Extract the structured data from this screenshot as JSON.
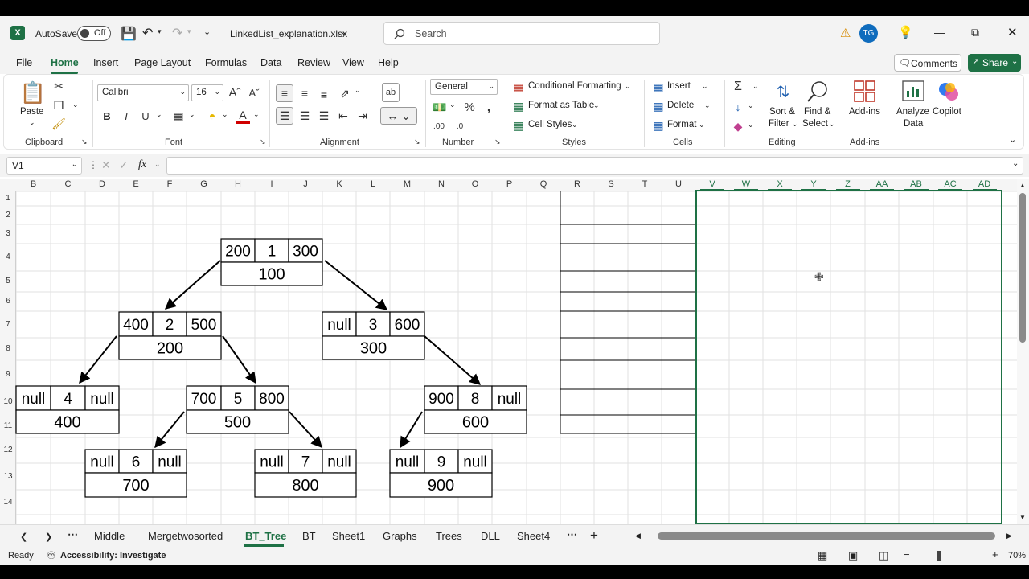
{
  "titlebar": {
    "autosave_label": "AutoSave",
    "autosave_state": "Off",
    "filename": "LinkedList_explanation.xlsx",
    "search_placeholder": "Search",
    "user_initials": "TG"
  },
  "menus": [
    "File",
    "Home",
    "Insert",
    "Page Layout",
    "Formulas",
    "Data",
    "Review",
    "View",
    "Help"
  ],
  "menu_active": "Home",
  "actions": {
    "comments": "Comments",
    "share": "Share"
  },
  "ribbon": {
    "clipboard": {
      "paste": "Paste",
      "label": "Clipboard"
    },
    "font": {
      "name": "Calibri",
      "size": "16",
      "label": "Font"
    },
    "alignment": {
      "label": "Alignment"
    },
    "number": {
      "format": "General",
      "label": "Number"
    },
    "styles": {
      "conditional": "Conditional Formatting",
      "table": "Format as Table",
      "cell": "Cell Styles",
      "label": "Styles"
    },
    "cells": {
      "insert": "Insert",
      "delete": "Delete",
      "format": "Format",
      "label": "Cells"
    },
    "editing": {
      "sort1": "Sort &",
      "sort2": "Filter",
      "find1": "Find &",
      "find2": "Select",
      "label": "Editing"
    },
    "addins": {
      "addins": "Add-ins",
      "label": "Add-ins"
    },
    "analyze": {
      "line1": "Analyze",
      "line2": "Data"
    },
    "copilot": "Copilot"
  },
  "formula_bar": {
    "cell_ref": "V1",
    "fx": "fx"
  },
  "columns": [
    "B",
    "C",
    "D",
    "E",
    "F",
    "G",
    "H",
    "I",
    "J",
    "K",
    "L",
    "M",
    "N",
    "O",
    "P",
    "Q",
    "R",
    "S",
    "T",
    "U",
    "V",
    "W",
    "X",
    "Y",
    "Z",
    "AA",
    "AB",
    "AC",
    "AD"
  ],
  "rows": [
    "1",
    "2",
    "3",
    "4",
    "5",
    "6",
    "7",
    "8",
    "9",
    "10",
    "11",
    "12",
    "13",
    "14"
  ],
  "tree_nodes": [
    {
      "id": "n1",
      "left": "200",
      "key": "1",
      "right": "300",
      "addr": "100"
    },
    {
      "id": "n2",
      "left": "400",
      "key": "2",
      "right": "500",
      "addr": "200"
    },
    {
      "id": "n3",
      "left": "null",
      "key": "3",
      "right": "600",
      "addr": "300"
    },
    {
      "id": "n4",
      "left": "null",
      "key": "4",
      "right": "null",
      "addr": "400"
    },
    {
      "id": "n5",
      "left": "700",
      "key": "5",
      "right": "800",
      "addr": "500"
    },
    {
      "id": "n8",
      "left": "900",
      "key": "8",
      "right": "null",
      "addr": "600"
    },
    {
      "id": "n6",
      "left": "null",
      "key": "6",
      "right": "null",
      "addr": "700"
    },
    {
      "id": "n7",
      "left": "null",
      "key": "7",
      "right": "null",
      "addr": "800"
    },
    {
      "id": "n9",
      "left": "null",
      "key": "9",
      "right": "null",
      "addr": "900"
    }
  ],
  "sheet_tabs": [
    "Middle",
    "Mergetwosorted",
    "BT_Tree",
    "BT",
    "Sheet1",
    "Graphs",
    "Trees",
    "DLL",
    "Sheet4"
  ],
  "active_tab": "BT_Tree",
  "status": {
    "ready": "Ready",
    "accessibility": "Accessibility: Investigate",
    "zoom": "70%"
  },
  "colors": {
    "accent": "#1e7145",
    "selection": "#1e7145"
  }
}
